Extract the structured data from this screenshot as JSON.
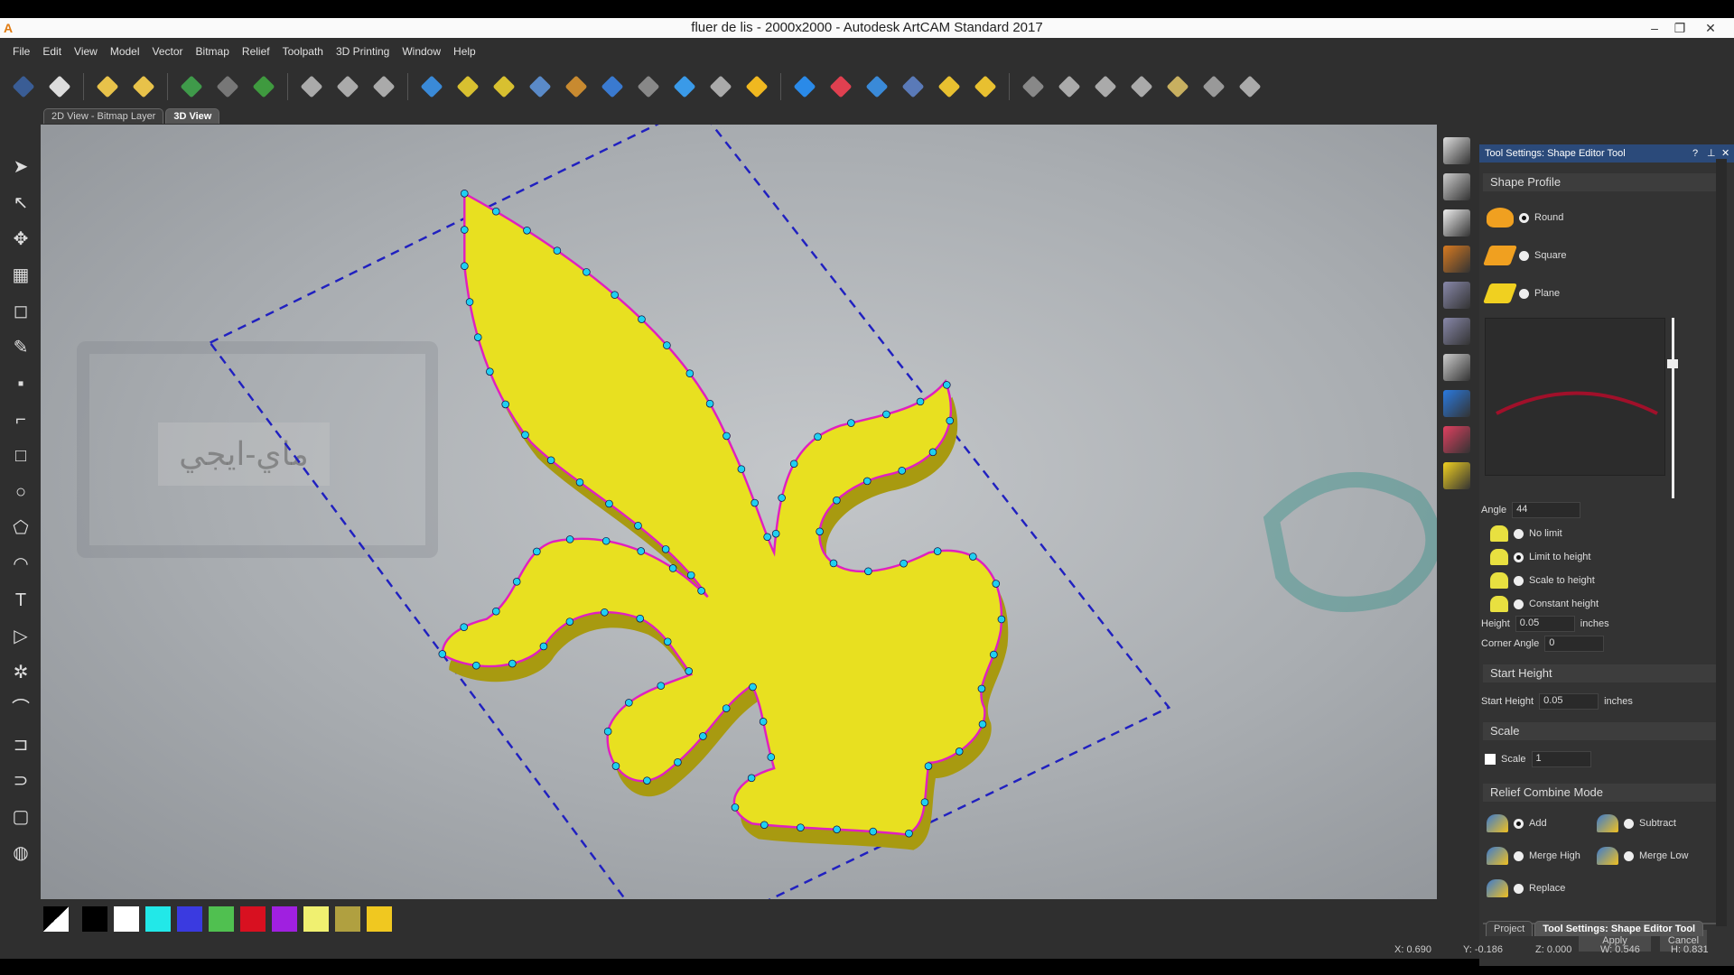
{
  "window": {
    "title": "fluer de lis - 2000x2000 - Autodesk ArtCAM Standard 2017",
    "logo": "A",
    "minimize": "–",
    "restore": "❐",
    "close": "✕"
  },
  "menu": [
    "File",
    "Edit",
    "View",
    "Model",
    "Vector",
    "Bitmap",
    "Relief",
    "Toolpath",
    "3D Printing",
    "Window",
    "Help"
  ],
  "toolbar_icons": [
    {
      "name": "save-icon",
      "color": "#3a5d95"
    },
    {
      "name": "undo-icon",
      "color": "#dddddd"
    },
    null,
    {
      "name": "open-project-icon",
      "color": "#e8c24a"
    },
    {
      "name": "open-recent-icon",
      "color": "#e8c24a"
    },
    null,
    {
      "name": "create-model-icon",
      "color": "#3f9a4a"
    },
    {
      "name": "model-size-icon",
      "color": "#777777"
    },
    {
      "name": "add-icon",
      "color": "#3f9a3f"
    },
    null,
    {
      "name": "node-editing-icon",
      "color": "#aaaaaa"
    },
    {
      "name": "smooth-vectors-icon",
      "color": "#aaaaaa"
    },
    {
      "name": "polyline-icon",
      "color": "#aaaaaa"
    },
    null,
    {
      "name": "relief-blue-icon",
      "color": "#3a8ad8"
    },
    {
      "name": "relief-yellow-1-icon",
      "color": "#d8c030"
    },
    {
      "name": "relief-yellow-2-icon",
      "color": "#d8c030"
    },
    {
      "name": "relief-mirror-icon",
      "color": "#5a8ac8"
    },
    {
      "name": "relief-texture-icon",
      "color": "#c88a30"
    },
    {
      "name": "relief-layer-icon",
      "color": "#3a7ad0"
    },
    {
      "name": "relief-stack-icon",
      "color": "#888888"
    },
    {
      "name": "relief-diamond-icon",
      "color": "#3a9ae8"
    },
    {
      "name": "relief-drop-icon",
      "color": "#aaaaaa"
    },
    {
      "name": "relief-droplet-icon",
      "color": "#f0b820"
    },
    null,
    {
      "name": "shape-editor-icon",
      "color": "#2a8ae8"
    },
    {
      "name": "eraser-icon",
      "color": "#e04050"
    },
    {
      "name": "sculpt-icon",
      "color": "#3a8ad8"
    },
    {
      "name": "relief-flat-icon",
      "color": "#5a7ab8"
    },
    {
      "name": "texture-icon",
      "color": "#e8c030"
    },
    {
      "name": "extrude-icon",
      "color": "#e8c030"
    },
    null,
    {
      "name": "reset-icon",
      "color": "#888888"
    },
    {
      "name": "text-icon",
      "color": "#aaaaaa"
    },
    {
      "name": "import-icon",
      "color": "#aaaaaa"
    },
    {
      "name": "layers-icon",
      "color": "#aaaaaa"
    },
    {
      "name": "bitmap-icon",
      "color": "#c8b060"
    },
    {
      "name": "toolpath-icon",
      "color": "#999999"
    },
    {
      "name": "export-icon",
      "color": "#aaaaaa"
    }
  ],
  "tabs": [
    {
      "label": "2D View - Bitmap Layer",
      "active": false
    },
    {
      "label": "3D View",
      "active": true
    }
  ],
  "left_tools": [
    {
      "name": "select-icon",
      "glyph": "➤"
    },
    {
      "name": "node-select-icon",
      "glyph": "↖"
    },
    {
      "name": "transform-icon",
      "glyph": "✥"
    },
    {
      "name": "grid-icon",
      "glyph": "▦"
    },
    {
      "name": "bitmap-select-icon",
      "glyph": "◻"
    },
    {
      "name": "paint-icon",
      "glyph": "✎"
    },
    {
      "name": "color-icon",
      "glyph": "▪"
    },
    {
      "name": "polyline-tool-icon",
      "glyph": "⌐"
    },
    {
      "name": "rectangle-icon",
      "glyph": "□"
    },
    {
      "name": "circle-icon",
      "glyph": "○"
    },
    {
      "name": "polygon-icon",
      "glyph": "⬠"
    },
    {
      "name": "arc-icon",
      "glyph": "◠"
    },
    {
      "name": "text-tool-icon",
      "glyph": "T"
    },
    {
      "name": "toolpath-tool-icon",
      "glyph": "▷"
    },
    {
      "name": "wand-icon",
      "glyph": "✲"
    },
    {
      "name": "fillet-icon",
      "glyph": "⌒"
    },
    {
      "name": "trim-icon",
      "glyph": "⊐"
    },
    {
      "name": "offset-icon",
      "glyph": "⊃"
    },
    {
      "name": "rounded-rect-icon",
      "glyph": "▢"
    },
    {
      "name": "texture-tool-icon",
      "glyph": "◍"
    }
  ],
  "right_tools": [
    {
      "name": "view-cube-icon",
      "color": "#dddddd"
    },
    {
      "name": "zoom-icon",
      "color": "#cccccc"
    },
    {
      "name": "top-view-icon",
      "color": "#eeeeee"
    },
    {
      "name": "cylinder-icon",
      "color": "#d87a20"
    },
    {
      "name": "plane-icon",
      "color": "#8888aa"
    },
    {
      "name": "layers-view-icon",
      "color": "#8888aa"
    },
    {
      "name": "shapes-icon",
      "color": "#cccccc"
    },
    {
      "name": "blue-relief-icon",
      "color": "#2a7ae0"
    },
    {
      "name": "red-relief-icon",
      "color": "#e04060"
    },
    {
      "name": "yellow-relief-icon",
      "color": "#f0d020"
    }
  ],
  "panel": {
    "title": "Tool Settings: Shape Editor Tool",
    "help": "?",
    "pin": "⊥",
    "close": "✕",
    "shape_profile": {
      "heading": "Shape Profile",
      "options": [
        {
          "label": "Round",
          "selected": true,
          "color": "#f0a020"
        },
        {
          "label": "Square",
          "selected": false,
          "color": "#f0a020"
        },
        {
          "label": "Plane",
          "selected": false,
          "color": "#f0d020"
        }
      ]
    },
    "angle": {
      "label": "Angle",
      "value": "44"
    },
    "limits": [
      {
        "label": "No limit",
        "selected": false
      },
      {
        "label": "Limit to height",
        "selected": true
      },
      {
        "label": "Scale to height",
        "selected": false
      },
      {
        "label": "Constant height",
        "selected": false
      }
    ],
    "height": {
      "label": "Height",
      "value": "0.05",
      "unit": "inches"
    },
    "corner_angle": {
      "label": "Corner Angle",
      "value": "0"
    },
    "start_height": {
      "heading": "Start Height",
      "label": "Start Height",
      "value": "0.05",
      "unit": "inches"
    },
    "scale": {
      "heading": "Scale",
      "label": "Scale",
      "checked": false,
      "value": "1"
    },
    "combine": {
      "heading": "Relief Combine Mode",
      "options": [
        {
          "label": "Add",
          "selected": true
        },
        {
          "label": "Subtract",
          "selected": false
        },
        {
          "label": "Merge High",
          "selected": false
        },
        {
          "label": "Merge Low",
          "selected": false
        },
        {
          "label": "Replace",
          "selected": false
        }
      ]
    },
    "apply": "Apply",
    "cancel": "Cancel",
    "bottom_tabs": [
      "Project",
      "Tool Settings: Shape Editor Tool"
    ]
  },
  "palette": [
    "#ffffff",
    "#000000",
    "#ffffff",
    "#22e8e8",
    "#3a3ae0",
    "#50c050",
    "#d81020",
    "#a020e0",
    "#f0f070",
    "#b0a040",
    "#f0c820"
  ],
  "status": {
    "x": "X: 0.690",
    "y": "Y: -0.186",
    "z": "Z: 0.000",
    "w": "W: 0.546",
    "h": "H: 0.831"
  },
  "watermark": "ماي-ايجي",
  "colors": {
    "relief": "#e8e020",
    "vector": "#e020c0",
    "nodes": "#20d0f0",
    "bounding_box": "#2020c0",
    "panel_header": "#2b4a7a"
  }
}
